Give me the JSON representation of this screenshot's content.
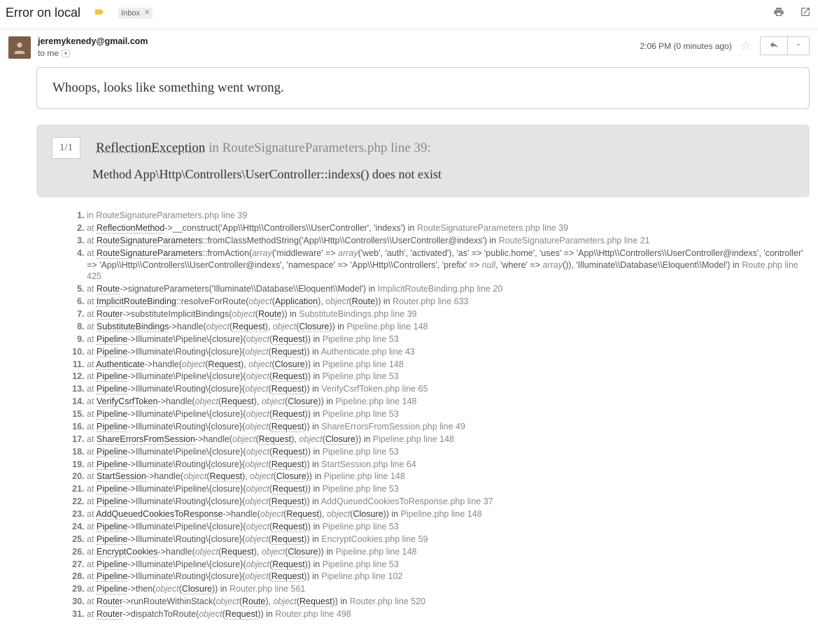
{
  "subject": "Error on local",
  "inbox_label": "Inbox",
  "from": "jeremykenedy@gmail.com",
  "to_line": "to me",
  "timestamp": "2:06 PM (0 minutes ago)",
  "whoops": "Whoops, looks like something went wrong.",
  "counter": "1/1",
  "exception_name": "ReflectionException",
  "exception_in": "in",
  "exception_file": "RouteSignatureParameters.php line 39",
  "exception_message": "Method App\\Http\\Controllers\\UserController::indexs() does not exist",
  "trace": [
    {
      "pre": "in ",
      "file": "RouteSignatureParameters.php line 39"
    },
    {
      "pre": "at ",
      "cls": "ReflectionMethod",
      "mid": "->__construct('App\\\\Http\\\\Controllers\\\\UserController', 'indexs') in ",
      "file": "RouteSignatureParameters.php line 39"
    },
    {
      "pre": "at ",
      "cls": "RouteSignatureParameters",
      "mid": "::fromClassMethodString('App\\\\Http\\\\Controllers\\\\UserController@indexs') in ",
      "file": "RouteSignatureParameters.php line 21"
    },
    {
      "pre": "at ",
      "cls": "RouteSignatureParameters",
      "mid": "::fromAction(<i>array</i>('middleware' => <i>array</i>('web', 'auth', 'activated'), 'as' => 'public.home', 'uses' => 'App\\\\Http\\\\Controllers\\\\UserController@indexs', 'controller' => 'App\\\\Http\\\\Controllers\\\\UserController@indexs', 'namespace' => 'App\\\\Http\\\\Controllers', 'prefix' => <i>null</i>, 'where' => <i>array</i>()), 'Illuminate\\\\Database\\\\Eloquent\\\\Model') in ",
      "file": "Route.php line 425"
    },
    {
      "pre": "at ",
      "cls": "Route",
      "mid": "->signatureParameters('Illuminate\\\\Database\\\\Eloquent\\\\Model') in ",
      "file": "ImplicitRouteBinding.php line 20"
    },
    {
      "pre": "at ",
      "cls": "ImplicitRouteBinding",
      "mid": "::resolveForRoute(<i>object</i>(<u>Application</u>), <i>object</i>(<u>Route</u>)) in ",
      "file": "Router.php line 633"
    },
    {
      "pre": "at ",
      "cls": "Router",
      "mid": "->substituteImplicitBindings(<i>object</i>(<u>Route</u>)) in ",
      "file": "SubstituteBindings.php line 39"
    },
    {
      "pre": "at ",
      "cls": "SubstituteBindings",
      "mid": "->handle(<i>object</i>(<u>Request</u>), <i>object</i>(<u>Closure</u>)) in ",
      "file": "Pipeline.php line 148"
    },
    {
      "pre": "at ",
      "cls": "Pipeline",
      "mid": "->Illuminate\\Pipeline\\{closure}(<i>object</i>(<u>Request</u>)) in ",
      "file": "Pipeline.php line 53"
    },
    {
      "pre": "at ",
      "cls": "Pipeline",
      "mid": "->Illuminate\\Routing\\{closure}(<i>object</i>(<u>Request</u>)) in ",
      "file": "Authenticate.php line 43"
    },
    {
      "pre": "at ",
      "cls": "Authenticate",
      "mid": "->handle(<i>object</i>(<u>Request</u>), <i>object</i>(<u>Closure</u>)) in ",
      "file": "Pipeline.php line 148"
    },
    {
      "pre": "at ",
      "cls": "Pipeline",
      "mid": "->Illuminate\\Pipeline\\{closure}(<i>object</i>(<u>Request</u>)) in ",
      "file": "Pipeline.php line 53"
    },
    {
      "pre": "at ",
      "cls": "Pipeline",
      "mid": "->Illuminate\\Routing\\{closure}(<i>object</i>(<u>Request</u>)) in ",
      "file": "VerifyCsrfToken.php line 65"
    },
    {
      "pre": "at ",
      "cls": "VerifyCsrfToken",
      "mid": "->handle(<i>object</i>(<u>Request</u>), <i>object</i>(<u>Closure</u>)) in ",
      "file": "Pipeline.php line 148"
    },
    {
      "pre": "at ",
      "cls": "Pipeline",
      "mid": "->Illuminate\\Pipeline\\{closure}(<i>object</i>(<u>Request</u>)) in ",
      "file": "Pipeline.php line 53"
    },
    {
      "pre": "at ",
      "cls": "Pipeline",
      "mid": "->Illuminate\\Routing\\{closure}(<i>object</i>(<u>Request</u>)) in ",
      "file": "ShareErrorsFromSession.php line 49"
    },
    {
      "pre": "at ",
      "cls": "ShareErrorsFromSession",
      "mid": "->handle(<i>object</i>(<u>Request</u>), <i>object</i>(<u>Closure</u>)) in ",
      "file": "Pipeline.php line 148"
    },
    {
      "pre": "at ",
      "cls": "Pipeline",
      "mid": "->Illuminate\\Pipeline\\{closure}(<i>object</i>(<u>Request</u>)) in ",
      "file": "Pipeline.php line 53"
    },
    {
      "pre": "at ",
      "cls": "Pipeline",
      "mid": "->Illuminate\\Routing\\{closure}(<i>object</i>(<u>Request</u>)) in ",
      "file": "StartSession.php line 64"
    },
    {
      "pre": "at ",
      "cls": "StartSession",
      "mid": "->handle(<i>object</i>(<u>Request</u>), <i>object</i>(<u>Closure</u>)) in ",
      "file": "Pipeline.php line 148"
    },
    {
      "pre": "at ",
      "cls": "Pipeline",
      "mid": "->Illuminate\\Pipeline\\{closure}(<i>object</i>(<u>Request</u>)) in ",
      "file": "Pipeline.php line 53"
    },
    {
      "pre": "at ",
      "cls": "Pipeline",
      "mid": "->Illuminate\\Routing\\{closure}(<i>object</i>(<u>Request</u>)) in ",
      "file": "AddQueuedCookiesToResponse.php line 37"
    },
    {
      "pre": "at ",
      "cls": "AddQueuedCookiesToResponse",
      "mid": "->handle(<i>object</i>(<u>Request</u>), <i>object</i>(<u>Closure</u>)) in ",
      "file": "Pipeline.php line 148"
    },
    {
      "pre": "at ",
      "cls": "Pipeline",
      "mid": "->Illuminate\\Pipeline\\{closure}(<i>object</i>(<u>Request</u>)) in ",
      "file": "Pipeline.php line 53"
    },
    {
      "pre": "at ",
      "cls": "Pipeline",
      "mid": "->Illuminate\\Routing\\{closure}(<i>object</i>(<u>Request</u>)) in ",
      "file": "EncryptCookies.php line 59"
    },
    {
      "pre": "at ",
      "cls": "EncryptCookies",
      "mid": "->handle(<i>object</i>(<u>Request</u>), <i>object</i>(<u>Closure</u>)) in ",
      "file": "Pipeline.php line 148"
    },
    {
      "pre": "at ",
      "cls": "Pipeline",
      "mid": "->Illuminate\\Pipeline\\{closure}(<i>object</i>(<u>Request</u>)) in ",
      "file": "Pipeline.php line 53"
    },
    {
      "pre": "at ",
      "cls": "Pipeline",
      "mid": "->Illuminate\\Routing\\{closure}(<i>object</i>(<u>Request</u>)) in ",
      "file": "Pipeline.php line 102"
    },
    {
      "pre": "at ",
      "cls": "Pipeline",
      "mid": "->then(<i>object</i>(<u>Closure</u>)) in ",
      "file": "Router.php line 561"
    },
    {
      "pre": "at ",
      "cls": "Router",
      "mid": "->runRouteWithinStack(<i>object</i>(<u>Route</u>), <i>object</i>(<u>Request</u>)) in ",
      "file": "Router.php line 520"
    },
    {
      "pre": "at ",
      "cls": "Router",
      "mid": "->dispatchToRoute(<i>object</i>(<u>Request</u>)) in ",
      "file": "Router.php line 498"
    }
  ]
}
